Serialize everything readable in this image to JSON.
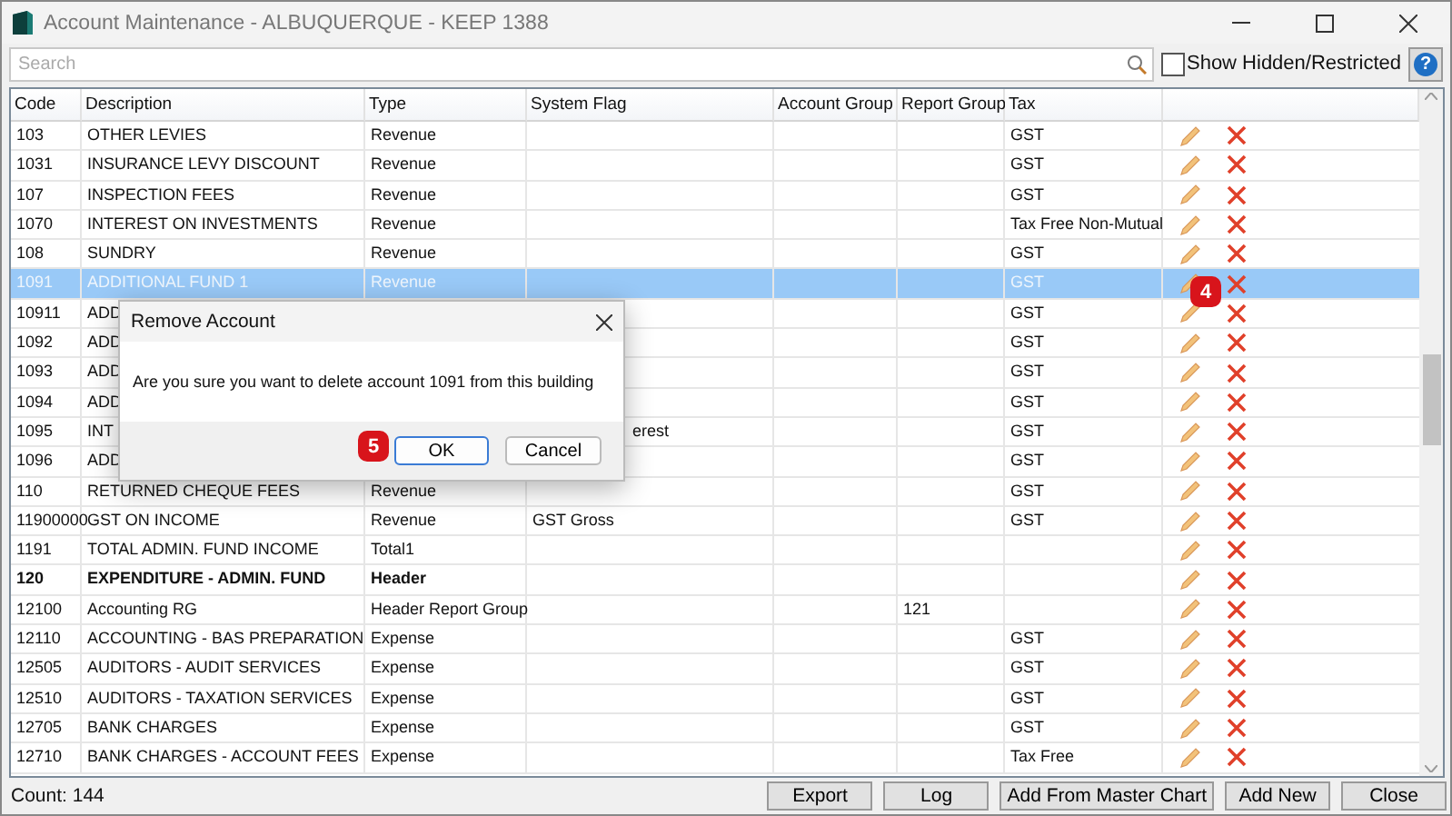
{
  "window": {
    "title": "Account Maintenance - ALBUQUERQUE - KEEP 1388"
  },
  "search": {
    "placeholder": "Search"
  },
  "show_hidden": {
    "label": "Show Hidden/Restricted",
    "checked": false
  },
  "help": {
    "label": "?"
  },
  "table": {
    "columns": [
      "Code",
      "Description",
      "Type",
      "System Flag",
      "Account Group",
      "Report Group",
      "Tax"
    ],
    "rows": [
      {
        "kind": "account",
        "selected": false,
        "code": "103",
        "description": "OTHER LEVIES",
        "type": "Revenue",
        "tax": "GST"
      },
      {
        "kind": "account",
        "selected": false,
        "code": "1031",
        "description": "INSURANCE LEVY DISCOUNT",
        "type": "Revenue",
        "tax": "GST"
      },
      {
        "kind": "account",
        "selected": false,
        "code": "107",
        "description": "INSPECTION FEES",
        "type": "Revenue",
        "tax": "GST"
      },
      {
        "kind": "account",
        "selected": false,
        "code": "1070",
        "description": "INTEREST ON INVESTMENTS",
        "type": "Revenue",
        "tax": "Tax Free Non-Mutual"
      },
      {
        "kind": "account",
        "selected": false,
        "code": "108",
        "description": "SUNDRY",
        "type": "Revenue",
        "tax": "GST"
      },
      {
        "kind": "account",
        "selected": true,
        "code": "1091",
        "description": "ADDITIONAL FUND 1",
        "type": "Revenue",
        "tax": "GST"
      },
      {
        "kind": "account",
        "selected": false,
        "code": "10911",
        "description": "ADD",
        "tax": "GST"
      },
      {
        "kind": "account",
        "selected": false,
        "code": "1092",
        "description": "ADD",
        "tax": "GST"
      },
      {
        "kind": "account",
        "selected": false,
        "code": "1093",
        "description": "ADD",
        "tax": "GST"
      },
      {
        "kind": "account",
        "selected": false,
        "code": "1094",
        "description": "ADD",
        "tax": "GST"
      },
      {
        "kind": "account",
        "selected": false,
        "code": "1095",
        "description": "INT",
        "system_flag": "erest",
        "tax": "GST"
      },
      {
        "kind": "account",
        "selected": false,
        "code": "1096",
        "description": "ADD",
        "tax": "GST"
      },
      {
        "kind": "account",
        "selected": false,
        "code": "110",
        "description": "RETURNED CHEQUE FEES",
        "type": "Revenue",
        "tax": "GST"
      },
      {
        "kind": "account",
        "selected": false,
        "code": "11900000",
        "description": "GST ON INCOME",
        "type": "Revenue",
        "system_flag": "GST Gross",
        "tax": "GST"
      },
      {
        "kind": "account",
        "selected": false,
        "code": "1191",
        "description": "TOTAL ADMIN. FUND INCOME",
        "type": "Total1"
      },
      {
        "kind": "header",
        "selected": false,
        "code": "120",
        "description": "EXPENDITURE - ADMIN. FUND",
        "type": "Header"
      },
      {
        "kind": "account",
        "selected": false,
        "code": "12100",
        "description": "Accounting RG",
        "type": "Header Report Group",
        "report_group": "121"
      },
      {
        "kind": "account",
        "selected": false,
        "code": "12110",
        "description": "ACCOUNTING - BAS PREPARATION",
        "type": "Expense",
        "tax": "GST"
      },
      {
        "kind": "account",
        "selected": false,
        "code": "12505",
        "description": "AUDITORS - AUDIT SERVICES",
        "type": "Expense",
        "tax": "GST"
      },
      {
        "kind": "account",
        "selected": false,
        "code": "12510",
        "description": "AUDITORS - TAXATION SERVICES",
        "type": "Expense",
        "tax": "GST"
      },
      {
        "kind": "account",
        "selected": false,
        "code": "12705",
        "description": "BANK CHARGES",
        "type": "Expense",
        "tax": "GST"
      },
      {
        "kind": "account",
        "selected": false,
        "code": "12710",
        "description": "BANK CHARGES - ACCOUNT FEES",
        "type": "Expense",
        "tax": "Tax Free"
      }
    ]
  },
  "count": "Count: 144",
  "buttons": [
    "Export",
    "Log",
    "Add From Master Chart",
    "Add New",
    "Close"
  ],
  "dialog": {
    "title": "Remove Account",
    "message": "Are you sure you want to delete account 1091 from this building",
    "buttons": [
      {
        "label": "OK",
        "kind": "default"
      },
      {
        "label": "Cancel",
        "kind": "normal"
      }
    ]
  },
  "step_badges": [
    "4",
    "5"
  ]
}
